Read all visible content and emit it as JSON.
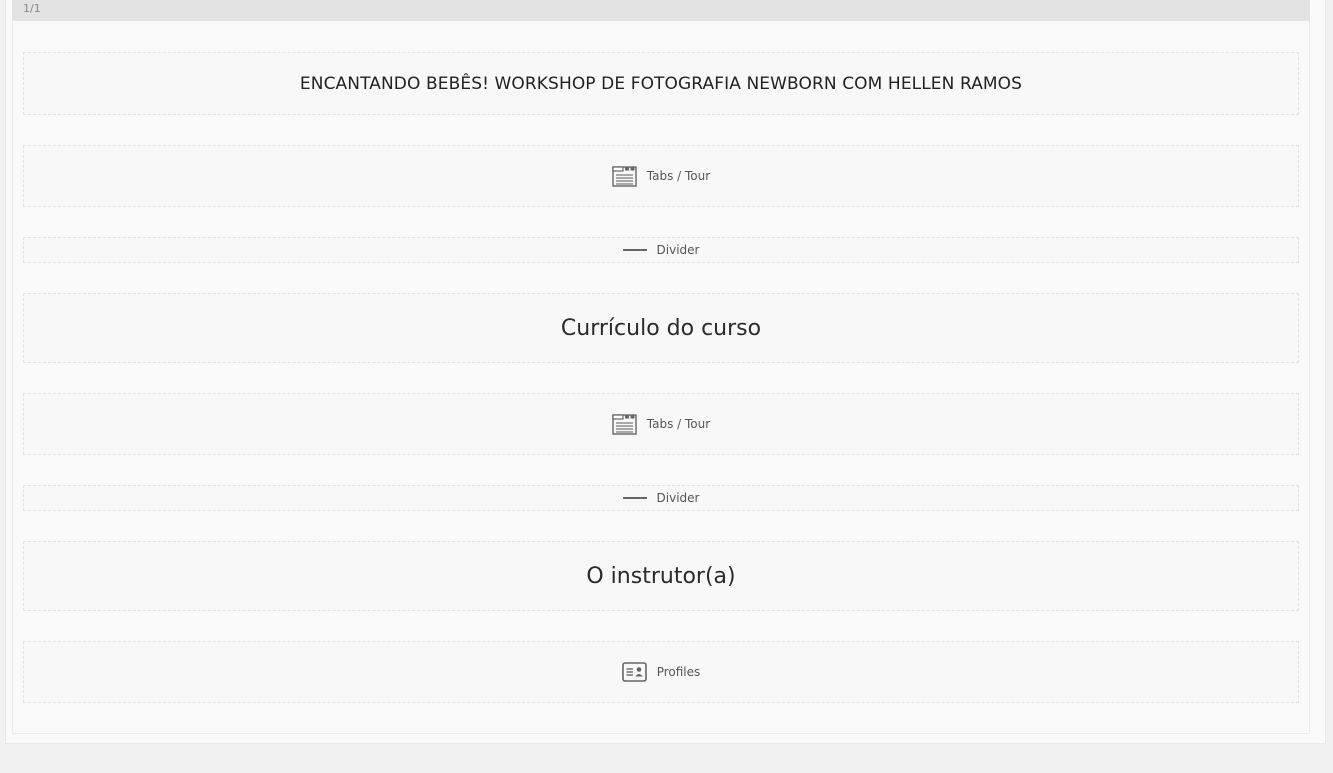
{
  "column": {
    "label": "1/1"
  },
  "blocks": {
    "title": "ENCANTANDO BEBÊS! WORKSHOP DE FOTOGRAFIA NEWBORN COM HELLEN RAMOS",
    "tabs1": {
      "icon": "tabs-icon",
      "label": "Tabs / Tour"
    },
    "divider1": {
      "icon": "divider-icon",
      "label": "Divider"
    },
    "heading1": "Currículo do curso",
    "tabs2": {
      "icon": "tabs-icon",
      "label": "Tabs / Tour"
    },
    "divider2": {
      "icon": "divider-icon",
      "label": "Divider"
    },
    "heading2": "O instrutor(a)",
    "profiles": {
      "icon": "profile-card-icon",
      "label": "Profiles"
    }
  }
}
